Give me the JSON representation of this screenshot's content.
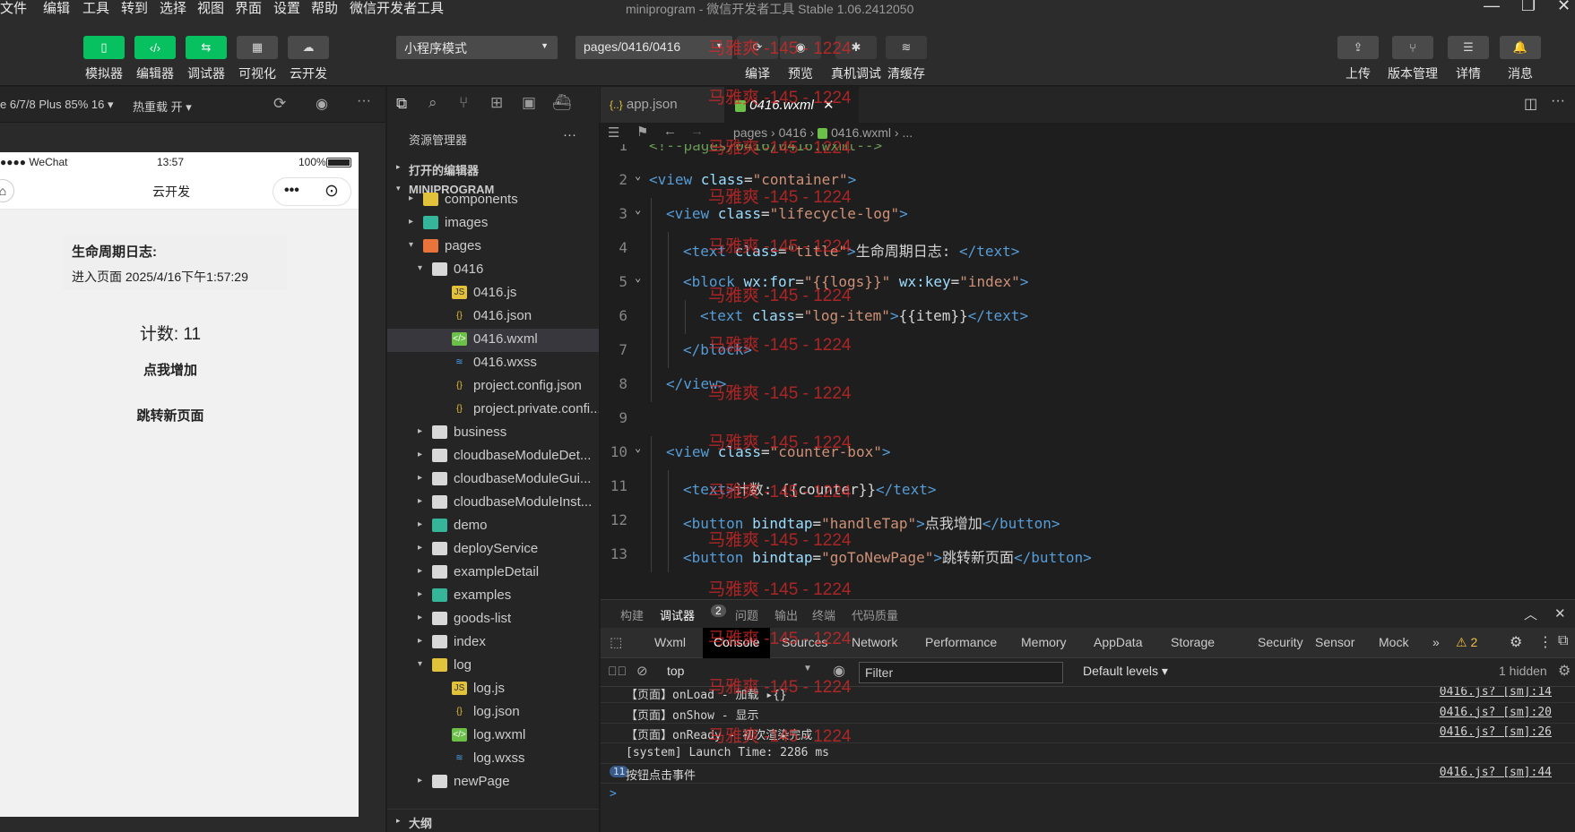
{
  "menubar": {
    "items": [
      "文件",
      "编辑",
      "工具",
      "转到",
      "选择",
      "视图",
      "界面",
      "设置",
      "帮助",
      "微信开发者工具"
    ],
    "title": "miniprogram - 微信开发者工具 Stable 1.06.2412050"
  },
  "toolbar": {
    "left_buttons": [
      {
        "label": "模拟器",
        "icon": "phone-icon"
      },
      {
        "label": "编辑器",
        "icon": "code-icon"
      },
      {
        "label": "调试器",
        "icon": "debug-icon"
      },
      {
        "label": "可视化",
        "icon": "layout-icon"
      },
      {
        "label": "云开发",
        "icon": "cloud-icon"
      }
    ],
    "mode_select": "小程序模式",
    "page_select": "pages/0416/0416",
    "center_buttons": [
      {
        "label": "编译",
        "icon": "refresh-icon"
      },
      {
        "label": "预览",
        "icon": "eye-icon"
      },
      {
        "label": "真机调试",
        "icon": "bug-icon"
      },
      {
        "label": "清缓存",
        "icon": "layers-icon"
      }
    ],
    "right_buttons": [
      {
        "label": "上传",
        "icon": "upload-icon"
      },
      {
        "label": "版本管理",
        "icon": "branch-icon"
      },
      {
        "label": "详情",
        "icon": "menu-icon"
      },
      {
        "label": "消息",
        "icon": "bell-icon"
      }
    ]
  },
  "simulator": {
    "device": "e 6/7/8 Plus 85% 16",
    "hot_reload": "热重载 开",
    "status_left": "●●●● WeChat",
    "status_time": "13:57",
    "status_battery": "100%",
    "nav_title": "云开发",
    "log_title": "生命周期日志:",
    "log_item": "进入页面 2025/4/16下午1:57:29",
    "counter": "计数: 11",
    "btn_increase": "点我增加",
    "btn_navigate": "跳转新页面"
  },
  "explorer": {
    "header": "资源管理器",
    "section_open": "打开的编辑器",
    "section_project": "MINIPROGRAM",
    "section_outline": "大纲",
    "rows": [
      {
        "name": "components",
        "depth": 1,
        "kind": "folder-yellow",
        "arrow": "▸"
      },
      {
        "name": "images",
        "depth": 1,
        "kind": "folder-teal",
        "arrow": "▸"
      },
      {
        "name": "pages",
        "depth": 1,
        "kind": "folder-orange",
        "arrow": "▾"
      },
      {
        "name": "0416",
        "depth": 2,
        "kind": "folder",
        "arrow": "▾"
      },
      {
        "name": "0416.js",
        "depth": 3,
        "kind": "js"
      },
      {
        "name": "0416.json",
        "depth": 3,
        "kind": "json"
      },
      {
        "name": "0416.wxml",
        "depth": 3,
        "kind": "wxml",
        "selected": true
      },
      {
        "name": "0416.wxss",
        "depth": 3,
        "kind": "wxss"
      },
      {
        "name": "project.config.json",
        "depth": 3,
        "kind": "json"
      },
      {
        "name": "project.private.confi...",
        "depth": 3,
        "kind": "json"
      },
      {
        "name": "business",
        "depth": 2,
        "kind": "folder",
        "arrow": "▸"
      },
      {
        "name": "cloudbaseModuleDet...",
        "depth": 2,
        "kind": "folder",
        "arrow": "▸"
      },
      {
        "name": "cloudbaseModuleGui...",
        "depth": 2,
        "kind": "folder",
        "arrow": "▸"
      },
      {
        "name": "cloudbaseModuleInst...",
        "depth": 2,
        "kind": "folder",
        "arrow": "▸"
      },
      {
        "name": "demo",
        "depth": 2,
        "kind": "folder-teal",
        "arrow": "▸"
      },
      {
        "name": "deployService",
        "depth": 2,
        "kind": "folder",
        "arrow": "▸"
      },
      {
        "name": "exampleDetail",
        "depth": 2,
        "kind": "folder",
        "arrow": "▸"
      },
      {
        "name": "examples",
        "depth": 2,
        "kind": "folder-teal",
        "arrow": "▸"
      },
      {
        "name": "goods-list",
        "depth": 2,
        "kind": "folder",
        "arrow": "▸"
      },
      {
        "name": "index",
        "depth": 2,
        "kind": "folder",
        "arrow": "▸"
      },
      {
        "name": "log",
        "depth": 2,
        "kind": "folder-yellow",
        "arrow": "▾"
      },
      {
        "name": "log.js",
        "depth": 3,
        "kind": "js"
      },
      {
        "name": "log.json",
        "depth": 3,
        "kind": "json"
      },
      {
        "name": "log.wxml",
        "depth": 3,
        "kind": "wxml"
      },
      {
        "name": "log.wxss",
        "depth": 3,
        "kind": "wxss"
      },
      {
        "name": "newPage",
        "depth": 2,
        "kind": "folder",
        "arrow": "▸"
      }
    ]
  },
  "editor": {
    "tabs": [
      {
        "label": "app.json",
        "icon": "{..}",
        "active": false
      },
      {
        "label": "0416.wxml",
        "icon": "wxml",
        "active": true
      }
    ],
    "breadcrumbs": [
      "pages",
      "0416",
      "0416.wxml",
      "..."
    ],
    "lines": [
      {
        "n": "1",
        "indent": 0,
        "tokens": [
          [
            "c",
            "<!--pages/0416/0416.wxml-->"
          ]
        ]
      },
      {
        "n": "2",
        "indent": 0,
        "fold": true,
        "tokens": [
          [
            "t",
            "<view "
          ],
          [
            "a",
            "class"
          ],
          [
            "p",
            "="
          ],
          [
            "s",
            "\"container\""
          ],
          [
            "t",
            ">"
          ]
        ]
      },
      {
        "n": "3",
        "indent": 1,
        "fold": true,
        "tokens": [
          [
            "t",
            "<view "
          ],
          [
            "a",
            "class"
          ],
          [
            "p",
            "="
          ],
          [
            "s",
            "\"lifecycle-log\""
          ],
          [
            "t",
            ">"
          ]
        ]
      },
      {
        "n": "4",
        "indent": 2,
        "tokens": [
          [
            "t",
            "<text "
          ],
          [
            "a",
            "class"
          ],
          [
            "p",
            "="
          ],
          [
            "s",
            "\"title\""
          ],
          [
            "t",
            ">"
          ],
          [
            "x",
            "生命周期日志: "
          ],
          [
            "t",
            "</text>"
          ]
        ]
      },
      {
        "n": "5",
        "indent": 2,
        "fold": true,
        "tokens": [
          [
            "t",
            "<block "
          ],
          [
            "a",
            "wx:for"
          ],
          [
            "p",
            "="
          ],
          [
            "s",
            "\"{{logs}}\""
          ],
          [
            "p",
            " "
          ],
          [
            "a",
            "wx:key"
          ],
          [
            "p",
            "="
          ],
          [
            "s",
            "\"index\""
          ],
          [
            "t",
            ">"
          ]
        ]
      },
      {
        "n": "6",
        "indent": 3,
        "tokens": [
          [
            "t",
            "<text "
          ],
          [
            "a",
            "class"
          ],
          [
            "p",
            "="
          ],
          [
            "s",
            "\"log-item\""
          ],
          [
            "t",
            ">"
          ],
          [
            "x",
            "{{item}}"
          ],
          [
            "t",
            "</text>"
          ]
        ]
      },
      {
        "n": "7",
        "indent": 2,
        "tokens": [
          [
            "t",
            "</block>"
          ]
        ]
      },
      {
        "n": "8",
        "indent": 1,
        "tokens": [
          [
            "t",
            "</view>"
          ]
        ]
      },
      {
        "n": "9",
        "indent": 0,
        "tokens": []
      },
      {
        "n": "10",
        "indent": 1,
        "fold": true,
        "tokens": [
          [
            "t",
            "<view "
          ],
          [
            "a",
            "class"
          ],
          [
            "p",
            "="
          ],
          [
            "s",
            "\"counter-box\""
          ],
          [
            "t",
            ">"
          ]
        ]
      },
      {
        "n": "11",
        "indent": 2,
        "tokens": [
          [
            "t",
            "<text>"
          ],
          [
            "x",
            "计数: {{counter}}"
          ],
          [
            "t",
            "</text>"
          ]
        ]
      },
      {
        "n": "12",
        "indent": 2,
        "tokens": [
          [
            "t",
            "<button "
          ],
          [
            "a",
            "bindtap"
          ],
          [
            "p",
            "="
          ],
          [
            "s",
            "\"handleTap\""
          ],
          [
            "t",
            ">"
          ],
          [
            "x",
            "点我增加"
          ],
          [
            "t",
            "</button>"
          ]
        ]
      },
      {
        "n": "13",
        "indent": 2,
        "tokens": [
          [
            "t",
            "<button "
          ],
          [
            "a",
            "bindtap"
          ],
          [
            "p",
            "="
          ],
          [
            "s",
            "\"goToNewPage\""
          ],
          [
            "t",
            ">"
          ],
          [
            "x",
            "跳转新页面"
          ],
          [
            "t",
            "</button>"
          ]
        ]
      }
    ]
  },
  "panel": {
    "tabs": [
      "构建",
      "调试器",
      "问题",
      "输出",
      "终端",
      "代码质量"
    ],
    "debugger_badge": "2",
    "devtools_tabs": [
      "Wxml",
      "Console",
      "Sources",
      "Network",
      "Performance",
      "Memory",
      "AppData",
      "Storage",
      "Security",
      "Sensor",
      "Mock"
    ],
    "active_devtool": "Console",
    "more": "»",
    "warnings": "⚠ 2",
    "context": "top",
    "filter_placeholder": "Filter",
    "levels": "Default levels",
    "hidden": "1 hidden",
    "logs": [
      {
        "msg": "【页面】onLoad - 加载 ▸{}",
        "src": "0416.js? [sm]:14"
      },
      {
        "msg": "【页面】onShow - 显示",
        "src": "0416.js? [sm]:20"
      },
      {
        "msg": "【页面】onReady - 初次渲染完成",
        "src": "0416.js? [sm]:26"
      },
      {
        "msg": "[system] Launch Time: 2286 ms",
        "src": ""
      },
      {
        "msg": "按钮点击事件",
        "src": "0416.js? [sm]:44",
        "count": "11"
      }
    ],
    "prompt": ">"
  },
  "watermark": "马雅爽 -145 - 1224",
  "colors": {
    "green": "#07c160",
    "background": "#1e1e1e",
    "sidebar": "#252526"
  }
}
